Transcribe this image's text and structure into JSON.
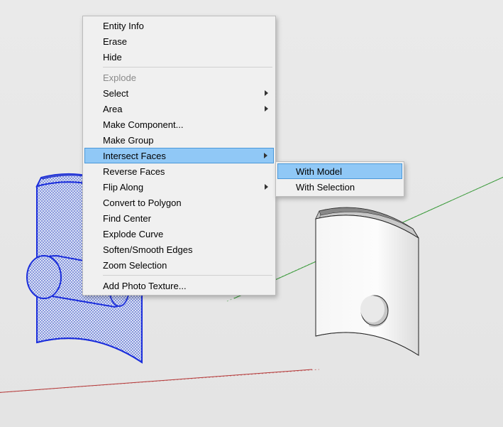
{
  "context_menu": {
    "items": [
      {
        "label": "Entity Info"
      },
      {
        "label": "Erase"
      },
      {
        "label": "Hide"
      },
      {
        "separator": true
      },
      {
        "label": "Explode",
        "disabled": true
      },
      {
        "label": "Select",
        "submenu": true
      },
      {
        "label": "Area",
        "submenu": true
      },
      {
        "label": "Make Component..."
      },
      {
        "label": "Make Group"
      },
      {
        "label": "Intersect Faces",
        "submenu": true,
        "highlight": true
      },
      {
        "label": "Reverse Faces"
      },
      {
        "label": "Flip Along",
        "submenu": true
      },
      {
        "label": "Convert to Polygon"
      },
      {
        "label": "Find Center"
      },
      {
        "label": "Explode Curve"
      },
      {
        "label": "Soften/Smooth Edges"
      },
      {
        "label": "Zoom Selection"
      },
      {
        "separator": true
      },
      {
        "label": "Add Photo Texture..."
      }
    ],
    "submenu": [
      {
        "label": "With Model",
        "highlight": true
      },
      {
        "label": "With Selection"
      }
    ]
  }
}
